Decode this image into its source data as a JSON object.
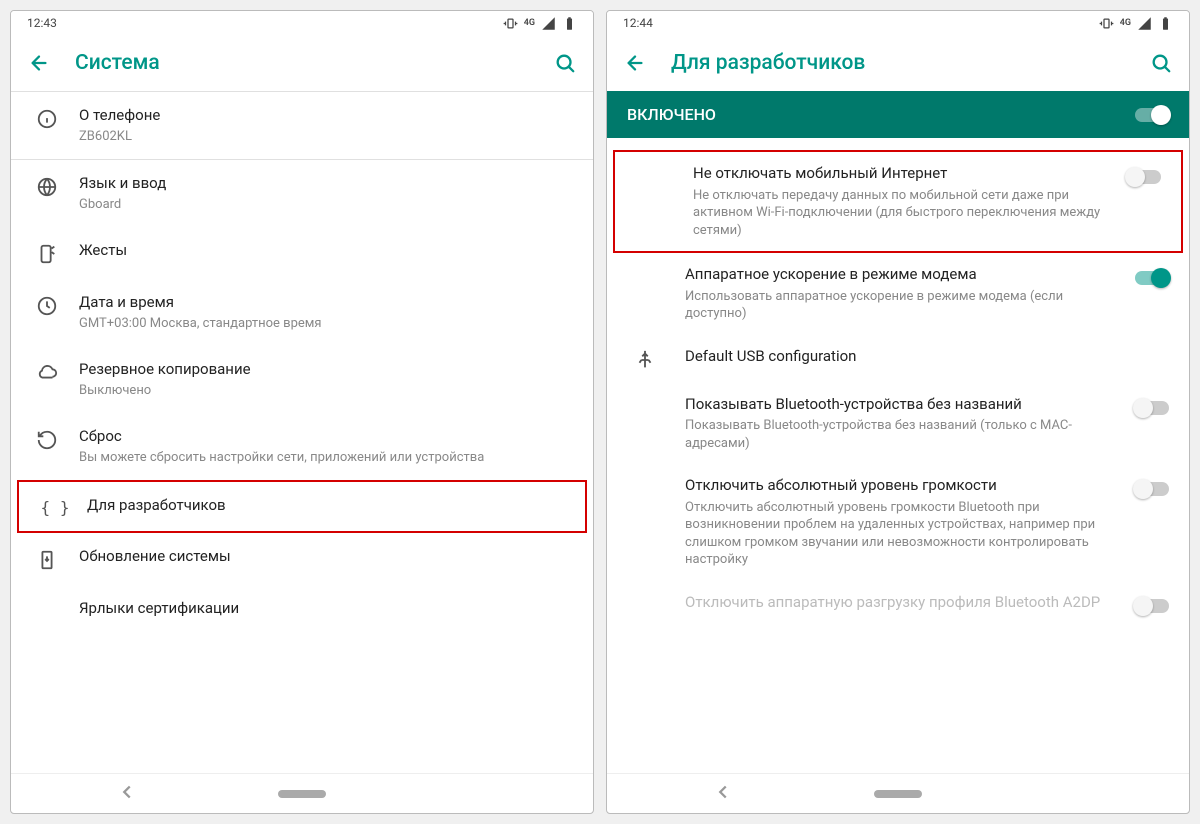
{
  "left": {
    "status_time": "12:43",
    "status_net": "4G",
    "title": "Система",
    "items": [
      {
        "primary": "О телефоне",
        "secondary": "ZB602KL",
        "icon": "info-icon"
      },
      {
        "primary": "Язык и ввод",
        "secondary": "Gboard",
        "icon": "globe-icon"
      },
      {
        "primary": "Жесты",
        "secondary": "",
        "icon": "gesture-icon"
      },
      {
        "primary": "Дата и время",
        "secondary": "GMT+03:00 Москва, стандартное время",
        "icon": "clock-icon"
      },
      {
        "primary": "Резервное копирование",
        "secondary": "Выключено",
        "icon": "cloud-icon"
      },
      {
        "primary": "Сброс",
        "secondary": "Вы можете сбросить настройки сети, приложений или устройства",
        "icon": "restore-icon"
      },
      {
        "primary": "Для разработчиков",
        "secondary": "",
        "icon": "braces-icon",
        "highlight": true
      },
      {
        "primary": "Обновление системы",
        "secondary": "",
        "icon": "update-icon"
      },
      {
        "primary": "Ярлыки сертификации",
        "secondary": "",
        "icon": ""
      }
    ]
  },
  "right": {
    "status_time": "12:44",
    "status_net": "4G",
    "title": "Для разработчиков",
    "enabled_label": "ВКЛЮЧЕНО",
    "items": [
      {
        "primary": "Не отключать мобильный Интернет",
        "secondary": "Не отключать передачу данных по мобильной сети даже при активном Wi-Fi-подключении (для быстрого переключения между сетями)",
        "switch": "off",
        "highlight": true
      },
      {
        "primary": "Аппаратное ускорение в режиме модема",
        "secondary": "Использовать аппаратное ускорение в режиме модема (если доступно)",
        "switch": "on"
      },
      {
        "primary": "Default USB configuration",
        "secondary": "",
        "icon": "usb-icon"
      },
      {
        "primary": "Показывать Bluetooth-устройства без названий",
        "secondary": "Показывать Bluetooth-устройства без названий (только с MAC-адресами)",
        "switch": "off"
      },
      {
        "primary": "Отключить абсолютный уровень громкости",
        "secondary": "Отключить абсолютный уровень громкости Bluetooth при возникновении проблем на удаленных устройствах, например при слишком громком звучании или невозможности контролировать настройку",
        "switch": "off"
      },
      {
        "primary": "Отключить аппаратную разгрузку профиля Bluetooth A2DP",
        "secondary": "",
        "switch": "off",
        "disabled": true
      }
    ]
  }
}
